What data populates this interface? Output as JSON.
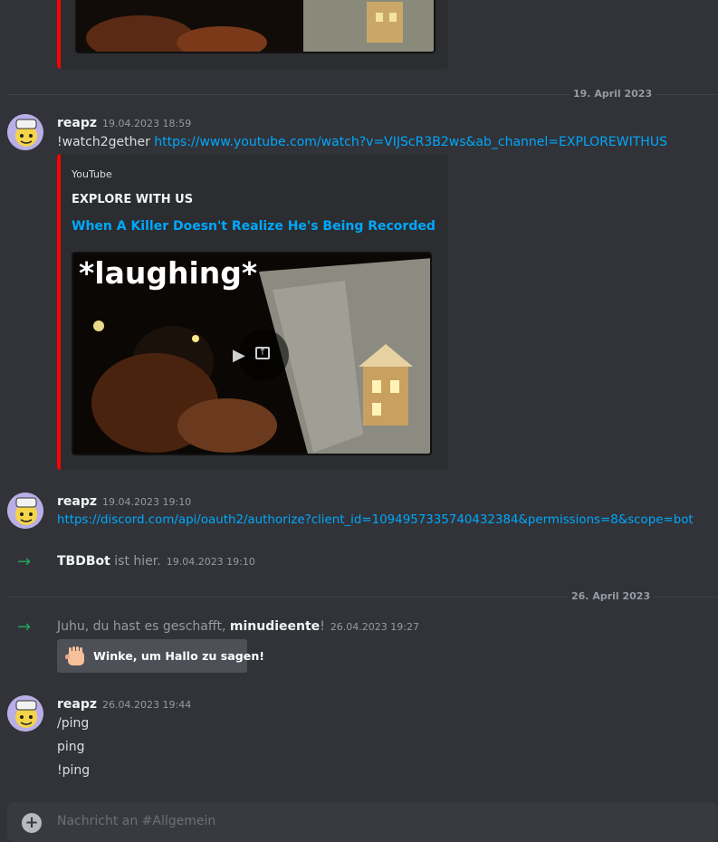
{
  "dividers": [
    {
      "label": "19. April 2023"
    },
    {
      "label": "26. April 2023"
    }
  ],
  "messages": [
    {
      "author": "reapz",
      "timestamp": "19.04.2023 18:59",
      "text_prefix": "!watch2gether",
      "link": "https://www.youtube.com/watch?v=VIJScR3B2ws&ab_channel=EXPLOREWITHUS",
      "embed": {
        "provider": "YouTube",
        "author": "EXPLORE WITH US",
        "title": "When A Killer Doesn't Realize He's Being Recorded",
        "thumbnail_caption": "*laughing*"
      }
    },
    {
      "author": "reapz",
      "timestamp": "19.04.2023 19:10",
      "link": "https://discord.com/api/oauth2/authorize?client_id=1094957335740432384&permissions=8&scope=bot"
    },
    {
      "author": "reapz",
      "timestamp": "26.04.2023 19:44",
      "lines": [
        "/ping",
        "ping",
        "!ping"
      ]
    }
  ],
  "system": [
    {
      "name": "TBDBot",
      "text": "ist hier.",
      "timestamp": "19.04.2023 19:10"
    },
    {
      "text_before": "Juhu, du hast es geschafft,",
      "name": "minudieente",
      "text_after": "!",
      "timestamp": "26.04.2023 19:27",
      "wave_button": "Winke, um Hallo zu sagen!"
    }
  ],
  "composer": {
    "placeholder": "Nachricht an #Allgemein"
  },
  "colors": {
    "accent_link": "#00a8fc",
    "embed_border": "#ff0000",
    "join_arrow": "#23a55a",
    "background": "#313338"
  }
}
